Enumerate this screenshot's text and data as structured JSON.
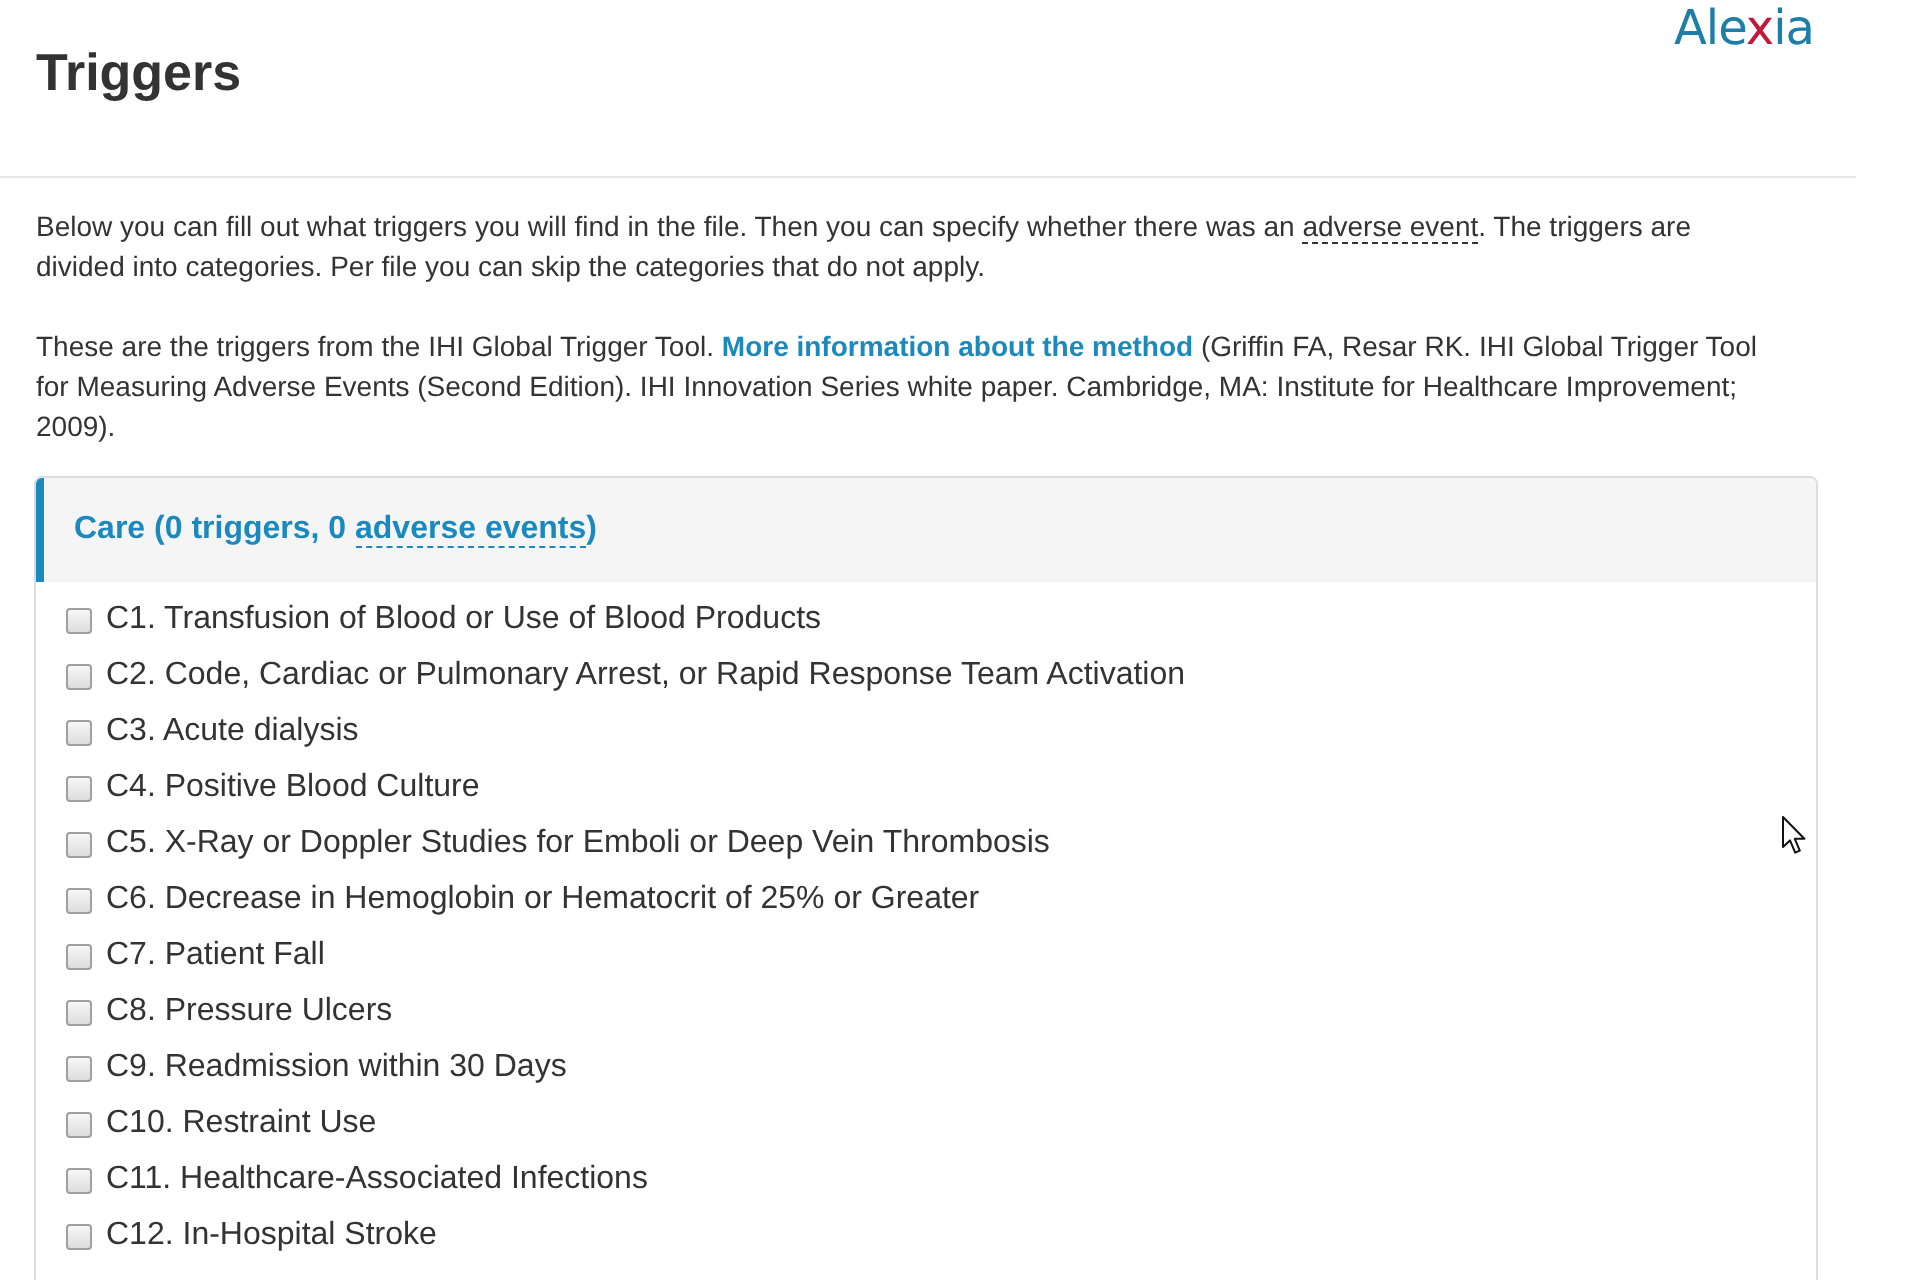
{
  "header": {
    "title": "Triggers",
    "logo": [
      {
        "kind": "plain",
        "text": "Ale"
      },
      {
        "kind": "accent",
        "text": "x"
      },
      {
        "kind": "plain",
        "text": "ia"
      }
    ]
  },
  "intro": [
    {
      "parts": [
        {
          "kind": "text",
          "text": "Below you can fill out what triggers you will find in the file. Then you can specify whether there was an "
        },
        {
          "kind": "term",
          "text": "adverse event"
        },
        {
          "kind": "text",
          "text": ". The triggers are divided into categories. Per file you can skip the categories that do not apply."
        }
      ]
    },
    {
      "parts": [
        {
          "kind": "text",
          "text": "These are the triggers from the IHI Global Trigger Tool. "
        },
        {
          "kind": "link",
          "text": "More information about the method"
        },
        {
          "kind": "text",
          "text": " (Griffin FA, Resar RK. IHI Global Trigger Tool for Measuring Adverse Events (Second Edition). IHI Innovation Series white paper. Cambridge, MA: Institute for Healthcare Improvement; 2009)."
        }
      ]
    }
  ],
  "category": {
    "title_parts": [
      {
        "kind": "text",
        "text": "Care (0 triggers, 0 "
      },
      {
        "kind": "term",
        "text": "adverse events"
      },
      {
        "kind": "text",
        "text": ")"
      }
    ],
    "items": [
      {
        "label": "C1. Transfusion of Blood or Use of Blood Products",
        "checked": false
      },
      {
        "label": "C2. Code, Cardiac or Pulmonary Arrest, or Rapid Response Team Activation",
        "checked": false
      },
      {
        "label": "C3. Acute dialysis",
        "checked": false
      },
      {
        "label": "C4. Positive Blood Culture",
        "checked": false
      },
      {
        "label": "C5. X-Ray or Doppler Studies for Emboli or Deep Vein Thrombosis",
        "checked": false
      },
      {
        "label": "C6. Decrease in Hemoglobin or Hematocrit of 25% or Greater",
        "checked": false
      },
      {
        "label": "C7. Patient Fall",
        "checked": false
      },
      {
        "label": "C8. Pressure Ulcers",
        "checked": false
      },
      {
        "label": "C9. Readmission within 30 Days",
        "checked": false
      },
      {
        "label": "C10. Restraint Use",
        "checked": false
      },
      {
        "label": "C11. Healthcare-Associated Infections",
        "checked": false
      },
      {
        "label": "C12. In-Hospital Stroke",
        "checked": false
      }
    ]
  }
}
